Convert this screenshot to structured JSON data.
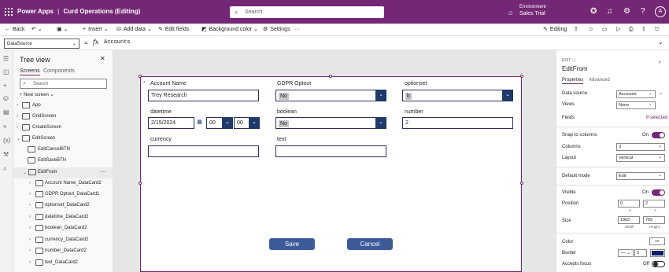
{
  "titlebar": {
    "app": "Power Apps",
    "separator": "|",
    "document": "Curd Operations (Editing)",
    "search_placeholder": "Search",
    "env_label": "Environment",
    "env_name": "Sales Trial",
    "avatar": "A"
  },
  "command_bar": {
    "back": "Back",
    "insert": "Insert",
    "add_data": "Add data",
    "edit_fields": "Edit fields",
    "background_color": "Background color",
    "settings": "Settings",
    "more": "···",
    "editing": "Editing"
  },
  "formula_bar": {
    "property": "DataSource",
    "formula": "Accounts"
  },
  "tree_view": {
    "title": "Tree view",
    "tabs": [
      "Screens",
      "Components"
    ],
    "search_placeholder": "Search",
    "new_screen": "New screen",
    "items": [
      {
        "label": "App"
      },
      {
        "label": "GridScreen"
      },
      {
        "label": "CreateScreen"
      },
      {
        "label": "EditScreen"
      },
      {
        "label": "EditCancelBTN"
      },
      {
        "label": "EditSaveBTN"
      },
      {
        "label": "EditFrom"
      },
      {
        "label": "Account Name_DataCard2"
      },
      {
        "label": "GDPR Optout_DataCard1"
      },
      {
        "label": "optionset_DataCard2"
      },
      {
        "label": "datetime_DataCard2"
      },
      {
        "label": "boolean_DataCard2"
      },
      {
        "label": "currency_DataCard2"
      },
      {
        "label": "number_DataCard2"
      },
      {
        "label": "text_DataCard2"
      }
    ]
  },
  "form": {
    "account_name": {
      "label": "Account Name",
      "required_mark": "*",
      "value": "Trey Research"
    },
    "gdpr_optout": {
      "label": "GDPR Optout",
      "value": "No"
    },
    "optionset": {
      "label": "optionset",
      "value": "b"
    },
    "datetime": {
      "label": "datetime",
      "date": "2/15/2024",
      "hour": "00",
      "minute": "00"
    },
    "boolean": {
      "label": "boolean",
      "value": "No"
    },
    "number": {
      "label": "number",
      "value": "2"
    },
    "currency": {
      "label": "currency",
      "value": ""
    },
    "text": {
      "label": "text",
      "value": ""
    },
    "save": "Save",
    "cancel": "Cancel"
  },
  "properties": {
    "type": "EDIT",
    "name": "EditFrom",
    "tabs": [
      "Properties",
      "Advanced"
    ],
    "data_source": {
      "label": "Data source",
      "value": "Accounts"
    },
    "views": {
      "label": "Views",
      "value": "None"
    },
    "fields": {
      "label": "Fields",
      "value": "8 selected"
    },
    "snap": {
      "label": "Snap to columns",
      "value": "On"
    },
    "columns": {
      "label": "Columns",
      "value": "3"
    },
    "layout": {
      "label": "Layout",
      "value": "Vertical"
    },
    "default_mode": {
      "label": "Default mode",
      "value": "Edit"
    },
    "visible": {
      "label": "Visible",
      "value": "On"
    },
    "position": {
      "label": "Position",
      "x": "0",
      "y": "2",
      "x_label": "X",
      "y_label": "Y"
    },
    "size": {
      "label": "Size",
      "width": "1362",
      "height": "765",
      "width_label": "Width",
      "height_label": "Height"
    },
    "color": {
      "label": "Color"
    },
    "border": {
      "label": "Border",
      "value": "0",
      "color": "#0f1b6b"
    },
    "accepts_focus": {
      "label": "Accepts focus",
      "value": "Off"
    }
  },
  "colors": {
    "brand": "#742774",
    "button": "#3d5a99",
    "dropdown": "#1f3a6a"
  }
}
